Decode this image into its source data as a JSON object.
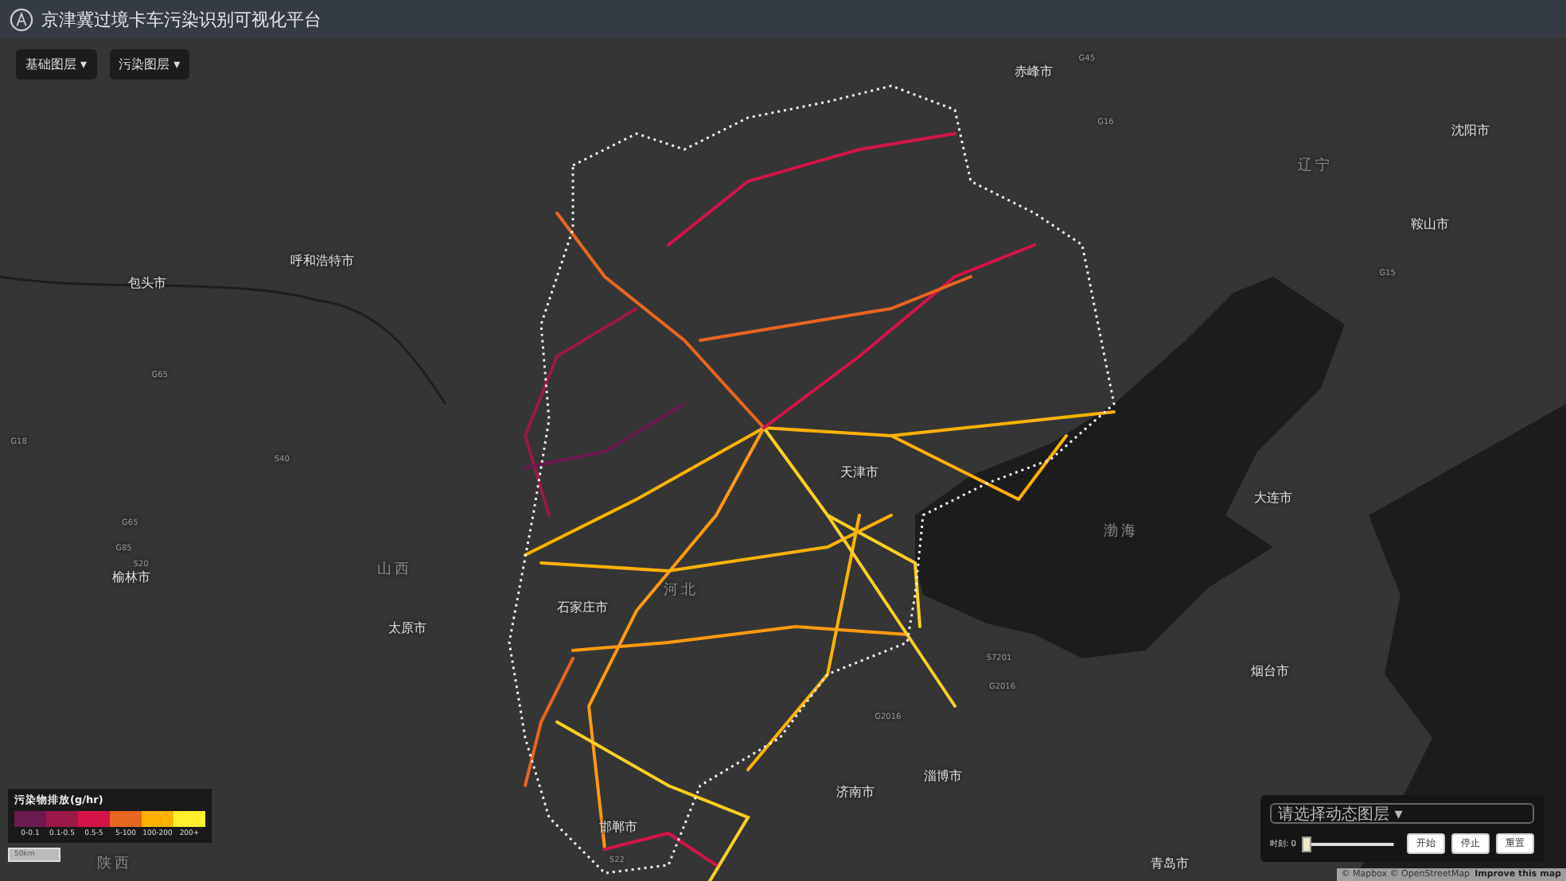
{
  "header": {
    "title": "京津冀过境卡车污染识别可视化平台"
  },
  "layer_menus": [
    {
      "label": "基础图层",
      "caret": "▾"
    },
    {
      "label": "污染图层",
      "caret": "▾"
    }
  ],
  "map_labels": [
    {
      "kind": "city",
      "text": "赤峰市"
    },
    {
      "kind": "city",
      "text": "沈阳市"
    },
    {
      "kind": "region",
      "text": "辽宁"
    },
    {
      "kind": "city",
      "text": "鞍山市"
    },
    {
      "kind": "city",
      "text": "呼和浩特市"
    },
    {
      "kind": "city",
      "text": "包头市"
    },
    {
      "kind": "city",
      "text": "天津市"
    },
    {
      "kind": "city",
      "text": "大连市"
    },
    {
      "kind": "sea",
      "text": "渤海"
    },
    {
      "kind": "region",
      "text": "河北"
    },
    {
      "kind": "region",
      "text": "山西"
    },
    {
      "kind": "city",
      "text": "榆林市"
    },
    {
      "kind": "city",
      "text": "石家庄市"
    },
    {
      "kind": "city",
      "text": "太原市"
    },
    {
      "kind": "city",
      "text": "烟台市"
    },
    {
      "kind": "city",
      "text": "淄博市"
    },
    {
      "kind": "city",
      "text": "济南市"
    },
    {
      "kind": "city",
      "text": "邯郸市"
    },
    {
      "kind": "region",
      "text": "陕西"
    },
    {
      "kind": "city",
      "text": "青岛市"
    },
    {
      "kind": "road",
      "text": "G45"
    },
    {
      "kind": "road",
      "text": "G16"
    },
    {
      "kind": "road",
      "text": "G15"
    },
    {
      "kind": "road",
      "text": "G65"
    },
    {
      "kind": "road",
      "text": "G18"
    },
    {
      "kind": "road",
      "text": "S40"
    },
    {
      "kind": "road",
      "text": "G65"
    },
    {
      "kind": "road",
      "text": "G85"
    },
    {
      "kind": "road",
      "text": "S20"
    },
    {
      "kind": "road",
      "text": "S7201"
    },
    {
      "kind": "road",
      "text": "G2016"
    },
    {
      "kind": "road",
      "text": "G2016"
    },
    {
      "kind": "road",
      "text": "S22"
    }
  ],
  "legend": {
    "title": "污染物排放(g/hr)",
    "items": [
      {
        "label": "0-0.1",
        "color": "#6b1a50"
      },
      {
        "label": "0.1-0.5",
        "color": "#9c1848"
      },
      {
        "label": "0.5-5",
        "color": "#d41448"
      },
      {
        "label": "5-100",
        "color": "#e8661f"
      },
      {
        "label": "100-200",
        "color": "#ffb300"
      },
      {
        "label": "200+",
        "color": "#fff030"
      }
    ]
  },
  "scale": {
    "label": "50km"
  },
  "playback": {
    "layer_select": {
      "placeholder": "请选择动态图层",
      "caret": "▾"
    },
    "time_label": "时刻: 0",
    "slider": {
      "level": 0
    },
    "buttons": [
      "开始",
      "停止",
      "重置"
    ]
  },
  "attribution": {
    "text": "© Mapbox © OpenStreetMap",
    "link": "Improve this map"
  }
}
